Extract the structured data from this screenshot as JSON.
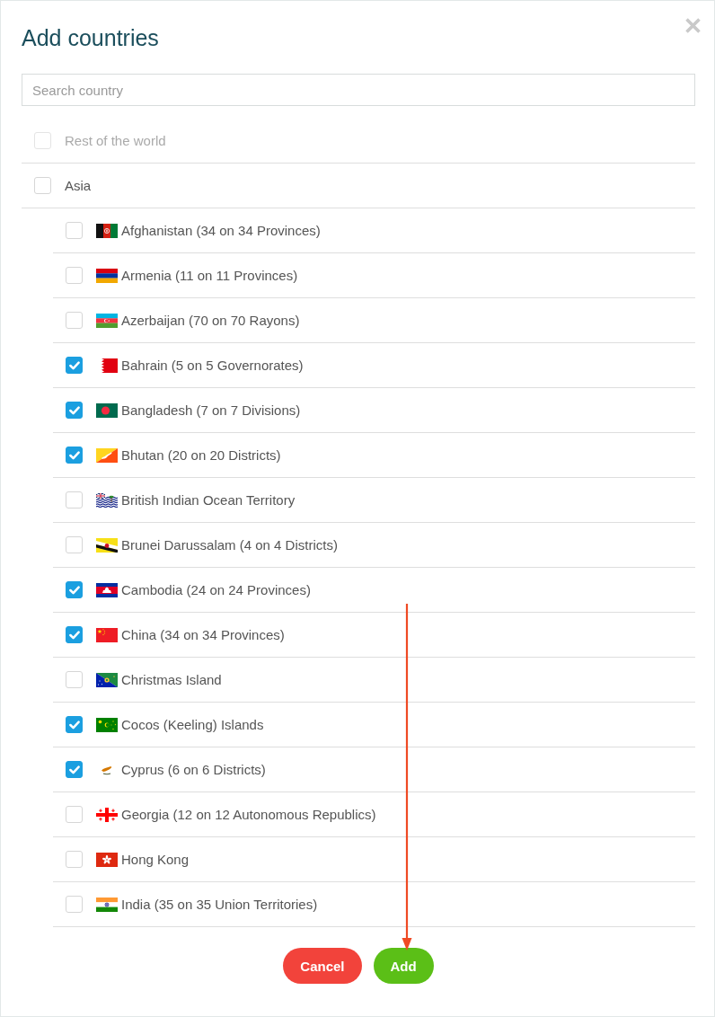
{
  "dialog": {
    "title": "Add countries"
  },
  "search": {
    "placeholder": "Search country"
  },
  "tree": [
    {
      "label": "Rest of the world",
      "checked": false,
      "disabled": true
    },
    {
      "label": "Asia",
      "checked": false,
      "disabled": false,
      "children": [
        {
          "label": "Afghanistan (34 on 34 Provinces)",
          "checked": false
        },
        {
          "label": "Armenia (11 on 11 Provinces)",
          "checked": false
        },
        {
          "label": "Azerbaijan (70 on 70 Rayons)",
          "checked": false
        },
        {
          "label": "Bahrain (5 on 5 Governorates)",
          "checked": true
        },
        {
          "label": "Bangladesh (7 on 7 Divisions)",
          "checked": true
        },
        {
          "label": "Bhutan (20 on 20 Districts)",
          "checked": true
        },
        {
          "label": "British Indian Ocean Territory",
          "checked": false
        },
        {
          "label": "Brunei Darussalam (4 on 4 Districts)",
          "checked": false
        },
        {
          "label": "Cambodia (24 on 24 Provinces)",
          "checked": true
        },
        {
          "label": "China (34 on 34 Provinces)",
          "checked": true
        },
        {
          "label": "Christmas Island",
          "checked": false
        },
        {
          "label": "Cocos (Keeling) Islands",
          "checked": true
        },
        {
          "label": "Cyprus (6 on 6 Districts)",
          "checked": true
        },
        {
          "label": "Georgia (12 on 12 Autonomous Republics)",
          "checked": false
        },
        {
          "label": "Hong Kong",
          "checked": false
        },
        {
          "label": "India (35 on 35 Union Territories)",
          "checked": false
        }
      ]
    }
  ],
  "buttons": [
    {
      "label": "Cancel",
      "kind": "cancel"
    },
    {
      "label": "Add",
      "kind": "confirm"
    }
  ]
}
